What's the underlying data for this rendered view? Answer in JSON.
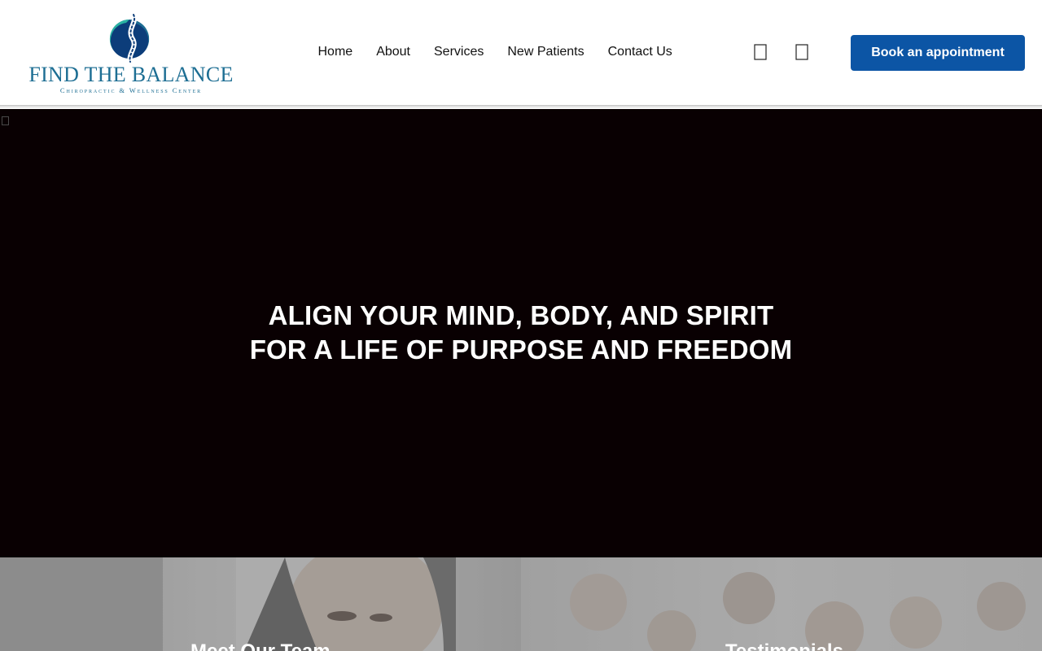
{
  "brand": {
    "title": "FIND THE BALANCE",
    "subtitle": "Chiropractic & Wellness Center",
    "colors": {
      "teal": "#1d6e93",
      "green": "#2bb3a3",
      "navy": "#0c3d7a"
    }
  },
  "nav": {
    "items": [
      {
        "label": "Home"
      },
      {
        "label": "About"
      },
      {
        "label": "Services"
      },
      {
        "label": "New Patients"
      },
      {
        "label": "Contact Us"
      }
    ]
  },
  "header_icons": [
    "search-icon",
    "user-icon"
  ],
  "cta": {
    "label": "Book an appointment",
    "color": "#0c55a5"
  },
  "hero": {
    "line1": "ALIGN YOUR MIND, BODY, AND SPIRIT",
    "line2": "FOR A LIFE OF PURPOSE AND FREEDOM",
    "background": "#090002"
  },
  "sections": {
    "team_label": "Meet Our Team",
    "testimonials_label": "Testimonials"
  }
}
